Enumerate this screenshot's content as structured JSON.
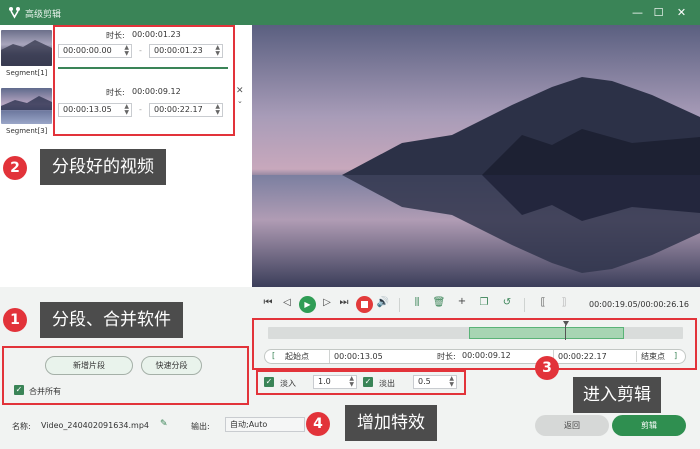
{
  "window": {
    "title": "高级剪辑",
    "minimize": "—",
    "maximize": "☐",
    "close": "✕"
  },
  "segments": [
    {
      "label": "Segment[1]",
      "duration_label": "时长:",
      "duration": "00:00:01.23",
      "start": "00:00:00.00",
      "end": "00:00:01.23",
      "sep": "-"
    },
    {
      "label": "Segment[3]",
      "duration_label": "时长:",
      "duration": "00:00:09.12",
      "start": "00:00:13.05",
      "end": "00:00:22.17",
      "sep": "-"
    }
  ],
  "callouts": [
    {
      "num": "2",
      "text": "分段好的视频"
    },
    {
      "num": "1",
      "text": "分段、合并软件"
    },
    {
      "num": "3",
      "text": "进入剪辑"
    },
    {
      "num": "4",
      "text": "增加特效"
    }
  ],
  "left_actions": {
    "new_segment": "新增片段",
    "quick_split": "快速分段",
    "merge_all": "合并所有"
  },
  "player": {
    "time": "00:00:19.05/00:00:26.16"
  },
  "range": {
    "start_btn": "起始点",
    "start_time": "00:00:13.05",
    "duration_label": "时长:",
    "duration": "00:00:09.12",
    "end_time": "00:00:22.17",
    "end_btn": "结束点",
    "left_bracket": "[",
    "right_bracket": "]"
  },
  "effects": {
    "fade_in_label": "淡入",
    "fade_in_value": "1.0",
    "fade_out_label": "淡出",
    "fade_out_value": "0.5"
  },
  "footer": {
    "name_label": "名称:",
    "name_value": "Video_240402091634.mp4",
    "output_label": "输出:",
    "output_value": "自动;Auto",
    "back_button": "返回",
    "cut_button": "剪辑"
  },
  "colors": {
    "accent": "#3a8457",
    "annotation": "#e2333a",
    "callout_bg": "#4c4c4c"
  }
}
